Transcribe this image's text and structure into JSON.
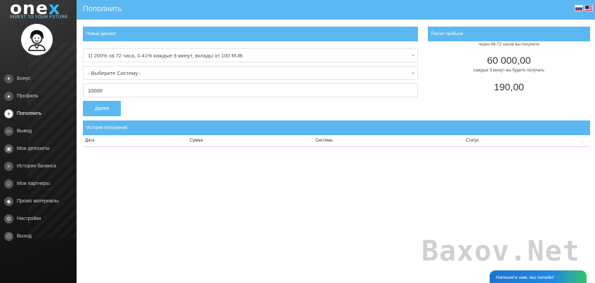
{
  "brand": {
    "logo_part1": "one",
    "logo_part2": "x",
    "tagline": "INVEST TO YOUR FUTURE"
  },
  "header": {
    "title": "Пополнить"
  },
  "sidebar": {
    "items": [
      {
        "label": "Бонус",
        "icon": "gift-icon"
      },
      {
        "label": "Профиль",
        "icon": "user-icon"
      },
      {
        "label": "Пополнить",
        "icon": "plus-icon",
        "active": true
      },
      {
        "label": "Вывод",
        "icon": "withdraw-icon"
      },
      {
        "label": "Мои депозиты",
        "icon": "deposits-icon"
      },
      {
        "label": "История баланса",
        "icon": "history-icon"
      },
      {
        "label": "Мои партнеры",
        "icon": "partners-icon"
      },
      {
        "label": "Промо материалы",
        "icon": "promo-icon"
      },
      {
        "label": "Настройки",
        "icon": "settings-icon"
      },
      {
        "label": "Выход",
        "icon": "logout-icon"
      }
    ]
  },
  "new_deposit": {
    "title": "Новый депозит",
    "plan_value": "1) 200% за 72 часа, 0.41% каждые 9 минут, вклады от 100 RUB",
    "system_value": "- Выберите Систему -",
    "amount_value": "10000",
    "next_label": "Далее"
  },
  "calc": {
    "title": "Расчет прибыли",
    "line1": "через 48-72 часов вы получите",
    "amount1": "60 000,00",
    "line2": "каждые 9 минут вы будете получать",
    "amount2": "190,00"
  },
  "history": {
    "title": "История пополнений",
    "columns": [
      "Дата",
      "Сумма",
      "Система",
      "Статус"
    ]
  },
  "watermark": "Baxov.Net",
  "chat": {
    "label": "Напишите нам, мы онлайн!"
  },
  "colors": {
    "accent": "#5cb8f2",
    "sidebar_bg": "#1d1d1d",
    "chat_start": "#1976d2",
    "chat_end": "#35c46a"
  }
}
